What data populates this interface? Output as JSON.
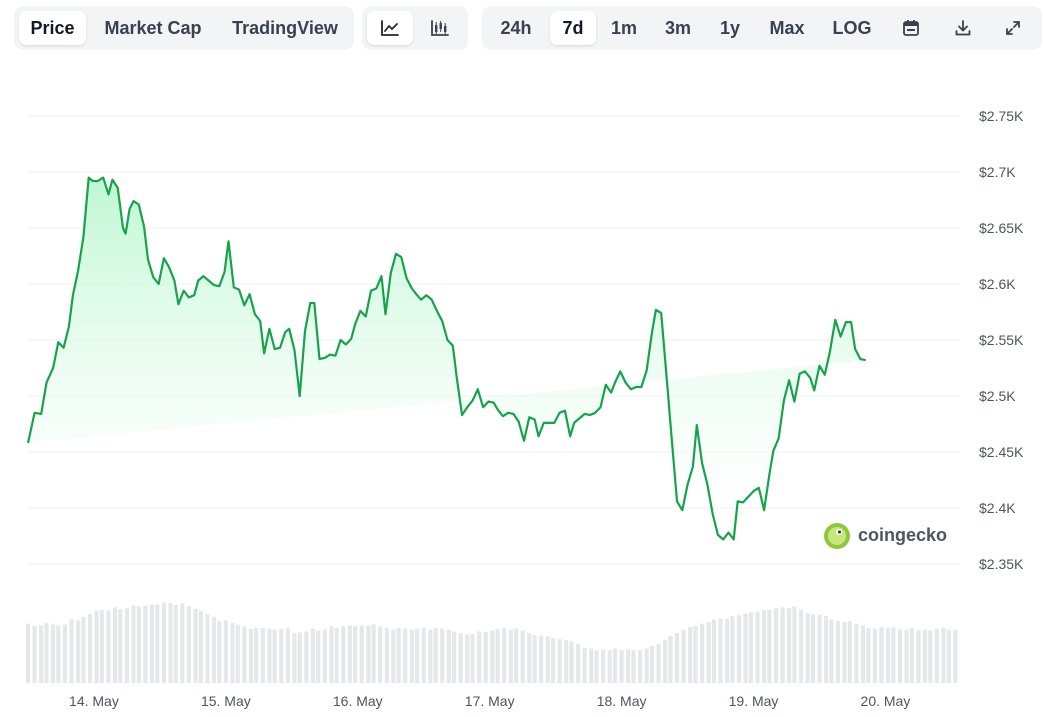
{
  "toolbar": {
    "views": [
      {
        "label": "Price",
        "active": true
      },
      {
        "label": "Market Cap",
        "active": false
      },
      {
        "label": "TradingView",
        "active": false
      }
    ],
    "chart_styles": [
      {
        "icon": "line-chart-icon",
        "active": true
      },
      {
        "icon": "candlestick-icon",
        "active": false
      }
    ],
    "ranges": [
      {
        "label": "24h",
        "active": false
      },
      {
        "label": "7d",
        "active": true
      },
      {
        "label": "1m",
        "active": false
      },
      {
        "label": "3m",
        "active": false
      },
      {
        "label": "1y",
        "active": false
      },
      {
        "label": "Max",
        "active": false
      },
      {
        "label": "LOG",
        "active": false
      }
    ],
    "actions": [
      {
        "icon": "calendar-icon"
      },
      {
        "icon": "download-icon"
      },
      {
        "icon": "expand-icon"
      }
    ]
  },
  "watermark": {
    "text": "coingecko"
  },
  "colors": {
    "line": "#16a34a",
    "area_top": "#bbf7d0",
    "volume": "#e5e7eb",
    "grid": "#eef0f2"
  },
  "chart_data": {
    "type": "area",
    "ylim": [
      2350,
      2750
    ],
    "y_ticks": [
      2350,
      2400,
      2450,
      2500,
      2550,
      2600,
      2650,
      2700,
      2750
    ],
    "y_tick_labels": [
      "$2.35K",
      "$2.4K",
      "$2.45K",
      "$2.5K",
      "$2.55K",
      "$2.6K",
      "$2.65K",
      "$2.7K",
      "$2.75K"
    ],
    "x_ticks": [
      0.5,
      1.5,
      2.5,
      3.5,
      4.5,
      5.5,
      6.5
    ],
    "x_tick_labels": [
      "14. May",
      "15. May",
      "16. May",
      "17. May",
      "18. May",
      "19. May",
      "20. May"
    ],
    "xlim": [
      0,
      7.05
    ],
    "price": {
      "x": [
        0.0,
        0.05,
        0.1,
        0.14,
        0.19,
        0.23,
        0.27,
        0.31,
        0.34,
        0.38,
        0.42,
        0.46,
        0.49,
        0.53,
        0.57,
        0.61,
        0.64,
        0.68,
        0.72,
        0.74,
        0.77,
        0.8,
        0.84,
        0.88,
        0.91,
        0.95,
        0.99,
        1.03,
        1.07,
        1.11,
        1.14,
        1.18,
        1.22,
        1.26,
        1.29,
        1.33,
        1.37,
        1.41,
        1.45,
        1.49,
        1.52,
        1.56,
        1.6,
        1.64,
        1.68,
        1.72,
        1.76,
        1.79,
        1.83,
        1.87,
        1.91,
        1.95,
        1.98,
        2.02,
        2.06,
        2.1,
        2.14,
        2.17,
        2.21,
        2.25,
        2.29,
        2.33,
        2.37,
        2.41,
        2.45,
        2.48,
        2.52,
        2.56,
        2.6,
        2.64,
        2.68,
        2.71,
        2.75,
        2.79,
        2.83,
        2.87,
        2.91,
        2.95,
        2.98,
        3.02,
        3.06,
        3.1,
        3.14,
        3.18,
        3.22,
        3.25,
        3.29,
        3.33,
        3.37,
        3.41,
        3.45,
        3.49,
        3.53,
        3.56,
        3.6,
        3.64,
        3.68,
        3.72,
        3.76,
        3.8,
        3.84,
        3.87,
        3.91,
        3.95,
        3.99,
        4.03,
        4.07,
        4.11,
        4.14,
        4.18,
        4.22,
        4.26,
        4.3,
        4.34,
        4.38,
        4.42,
        4.45,
        4.49,
        4.53,
        4.57,
        4.61,
        4.65,
        4.69,
        4.73,
        4.76,
        4.8,
        4.84,
        4.88,
        4.92,
        4.96,
        5.0,
        5.04,
        5.07,
        5.11,
        5.15,
        5.19,
        5.23,
        5.27,
        5.31,
        5.35,
        5.38,
        5.42,
        5.46,
        5.5,
        5.54,
        5.58,
        5.62,
        5.65,
        5.69,
        5.73,
        5.77,
        5.81,
        5.85,
        5.89,
        5.93,
        5.96,
        6.0,
        6.04,
        6.08,
        6.12,
        6.16,
        6.2,
        6.24,
        6.27,
        6.31,
        6.35,
        6.39,
        6.43,
        6.47,
        6.51,
        6.55,
        6.58,
        6.62,
        6.66,
        6.7,
        6.74,
        6.78,
        6.82,
        6.86,
        6.89,
        6.93,
        6.97,
        7.01,
        7.05
      ],
      "y": [
        2458,
        2485,
        2484,
        2512,
        2525,
        2548,
        2543,
        2562,
        2590,
        2612,
        2642,
        2695,
        2692,
        2692,
        2695,
        2680,
        2693,
        2686,
        2650,
        2645,
        2667,
        2674,
        2671,
        2651,
        2622,
        2606,
        2600,
        2623,
        2615,
        2603,
        2582,
        2594,
        2588,
        2590,
        2603,
        2607,
        2603,
        2599,
        2598,
        2611,
        2638,
        2597,
        2595,
        2581,
        2591,
        2573,
        2567,
        2538,
        2560,
        2542,
        2543,
        2557,
        2560,
        2541,
        2500,
        2558,
        2583,
        2583,
        2533,
        2534,
        2537,
        2536,
        2550,
        2546,
        2551,
        2564,
        2576,
        2571,
        2594,
        2596,
        2607,
        2573,
        2610,
        2627,
        2624,
        2605,
        2596,
        2590,
        2586,
        2590,
        2586,
        2576,
        2567,
        2550,
        2545,
        2517,
        2483,
        2490,
        2496,
        2506,
        2490,
        2495,
        2494,
        2488,
        2482,
        2485,
        2484,
        2477,
        2460,
        2481,
        2479,
        2464,
        2476,
        2476,
        2476,
        2485,
        2487,
        2464,
        2476,
        2480,
        2484,
        2483,
        2485,
        2490,
        2510,
        2503,
        2512,
        2522,
        2512,
        2506,
        2508,
        2508,
        2523,
        2557,
        2577,
        2574,
        2518,
        2462,
        2406,
        2398,
        2421,
        2437,
        2474,
        2440,
        2421,
        2395,
        2376,
        2372,
        2378,
        2372,
        2406,
        2405,
        2410,
        2415,
        2418,
        2398,
        2430,
        2451,
        2462,
        2496,
        2514,
        2495,
        2520,
        2522,
        2516,
        2505,
        2527,
        2519,
        2540,
        2568,
        2553,
        2566,
        2566,
        2542,
        2533,
        2532
      ]
    },
    "volume": {
      "x": [
        0.0,
        0.05,
        0.1,
        0.14,
        0.19,
        0.23,
        0.28,
        0.33,
        0.38,
        0.42,
        0.47,
        0.52,
        0.56,
        0.61,
        0.66,
        0.7,
        0.75,
        0.8,
        0.84,
        0.89,
        0.94,
        0.98,
        1.03,
        1.08,
        1.12,
        1.17,
        1.22,
        1.27,
        1.31,
        1.36,
        1.41,
        1.45,
        1.5,
        1.55,
        1.59,
        1.64,
        1.69,
        1.73,
        1.78,
        1.83,
        1.87,
        1.92,
        1.97,
        2.02,
        2.06,
        2.11,
        2.16,
        2.2,
        2.25,
        2.3,
        2.34,
        2.39,
        2.44,
        2.48,
        2.53,
        2.58,
        2.62,
        2.67,
        2.72,
        2.77,
        2.81,
        2.86,
        2.91,
        2.95,
        3.0,
        3.05,
        3.09,
        3.14,
        3.19,
        3.23,
        3.28,
        3.33,
        3.37,
        3.42,
        3.47,
        3.52,
        3.56,
        3.61,
        3.66,
        3.7,
        3.75,
        3.8,
        3.84,
        3.89,
        3.94,
        3.98,
        4.03,
        4.08,
        4.12,
        4.17,
        4.22,
        4.27,
        4.31,
        4.36,
        4.41,
        4.45,
        4.5,
        4.55,
        4.59,
        4.64,
        4.69,
        4.73,
        4.78,
        4.83,
        4.87,
        4.92,
        4.97,
        5.02,
        5.06,
        5.11,
        5.16,
        5.2,
        5.25,
        5.3,
        5.34,
        5.39,
        5.44,
        5.48,
        5.53,
        5.58,
        5.62,
        5.67,
        5.72,
        5.77,
        5.81,
        5.86,
        5.91,
        5.95,
        6.0,
        6.05,
        6.09,
        6.14,
        6.19,
        6.23,
        6.28,
        6.33,
        6.37,
        6.42,
        6.47,
        6.52,
        6.56,
        6.61,
        6.66,
        6.7,
        6.75,
        6.8,
        6.84,
        6.89,
        6.94,
        6.98,
        7.03
      ],
      "y": [
        0.69,
        0.66,
        0.67,
        0.7,
        0.68,
        0.67,
        0.68,
        0.74,
        0.73,
        0.77,
        0.8,
        0.84,
        0.85,
        0.84,
        0.88,
        0.86,
        0.87,
        0.9,
        0.89,
        0.9,
        0.91,
        0.91,
        0.93,
        0.93,
        0.91,
        0.93,
        0.89,
        0.86,
        0.84,
        0.8,
        0.77,
        0.72,
        0.73,
        0.7,
        0.68,
        0.66,
        0.63,
        0.64,
        0.64,
        0.63,
        0.62,
        0.63,
        0.64,
        0.58,
        0.59,
        0.6,
        0.63,
        0.61,
        0.62,
        0.66,
        0.64,
        0.66,
        0.67,
        0.66,
        0.67,
        0.67,
        0.68,
        0.66,
        0.64,
        0.62,
        0.64,
        0.63,
        0.62,
        0.63,
        0.64,
        0.62,
        0.64,
        0.63,
        0.62,
        0.6,
        0.58,
        0.56,
        0.57,
        0.6,
        0.59,
        0.61,
        0.63,
        0.64,
        0.62,
        0.63,
        0.61,
        0.58,
        0.56,
        0.55,
        0.54,
        0.52,
        0.51,
        0.5,
        0.48,
        0.45,
        0.41,
        0.4,
        0.38,
        0.39,
        0.38,
        0.4,
        0.38,
        0.39,
        0.38,
        0.38,
        0.4,
        0.43,
        0.45,
        0.5,
        0.55,
        0.58,
        0.62,
        0.65,
        0.66,
        0.69,
        0.71,
        0.74,
        0.75,
        0.75,
        0.78,
        0.79,
        0.81,
        0.82,
        0.83,
        0.85,
        0.85,
        0.87,
        0.88,
        0.87,
        0.89,
        0.85,
        0.81,
        0.8,
        0.79,
        0.78,
        0.74,
        0.72,
        0.71,
        0.72,
        0.69,
        0.67,
        0.64,
        0.63,
        0.65,
        0.64,
        0.65,
        0.62,
        0.62,
        0.64,
        0.61,
        0.62,
        0.61,
        0.63,
        0.64,
        0.62,
        0.62
      ]
    }
  }
}
